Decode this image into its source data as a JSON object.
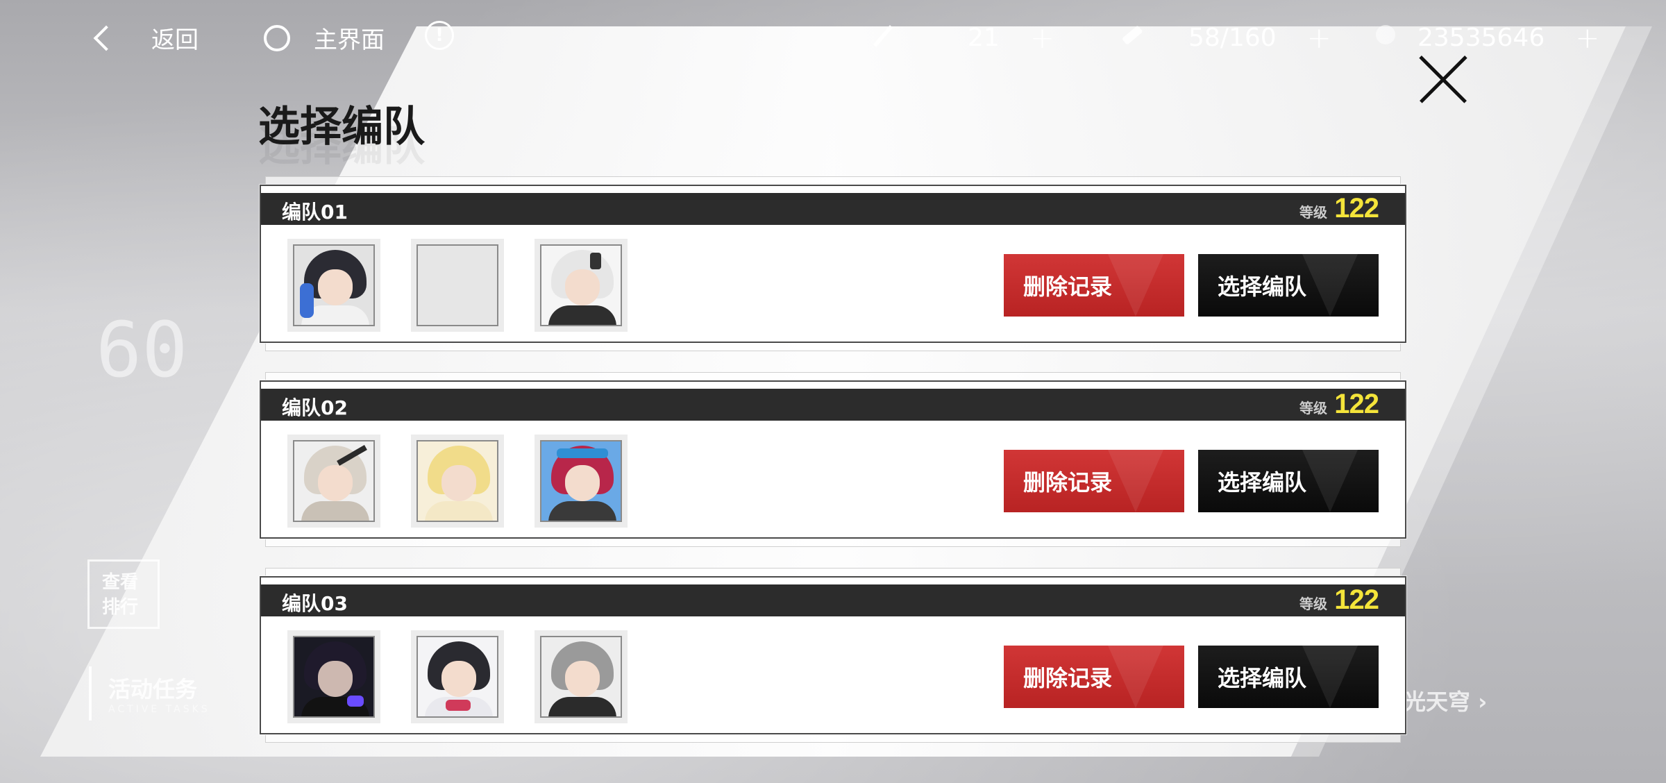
{
  "topbar": {
    "back_label": "返回",
    "home_label": "主界面",
    "info_label": "!",
    "resources": [
      {
        "icon": "energy-icon",
        "value": "21"
      },
      {
        "icon": "stamina-icon",
        "value": "58/160"
      },
      {
        "icon": "currency-icon",
        "value": "23535646"
      }
    ],
    "plus": "+"
  },
  "title": "选择编队",
  "level_label": "等级",
  "teams": [
    {
      "name": "编队01",
      "level": "122",
      "members": [
        {
          "kind": "character",
          "hair": "#2b2b33",
          "accent": "#3c6fd4",
          "body": "#f2f2f2"
        },
        {
          "kind": "empty"
        },
        {
          "kind": "character",
          "hair": "#e6e6e6",
          "accent": "#333333",
          "body": "#2e2e2e"
        }
      ],
      "delete_label": "删除记录",
      "select_label": "选择编队"
    },
    {
      "name": "编队02",
      "level": "122",
      "members": [
        {
          "kind": "character",
          "hair": "#d9d2c8",
          "accent": "#2a2a2a",
          "body": "#c9c1b6"
        },
        {
          "kind": "character",
          "hair": "#f1dc8a",
          "accent": "#e0c36a",
          "body": "#f4e8c6"
        },
        {
          "kind": "character",
          "hair": "#b8264a",
          "accent": "#2f8fd4",
          "body": "#3a3a3a"
        }
      ],
      "delete_label": "删除记录",
      "select_label": "选择编队"
    },
    {
      "name": "编队03",
      "level": "122",
      "members": [
        {
          "kind": "character",
          "hair": "#1f1a2c",
          "accent": "#6a4cff",
          "body": "#121212"
        },
        {
          "kind": "character",
          "hair": "#2a2a30",
          "accent": "#d03a5a",
          "body": "#e9e9ee"
        },
        {
          "kind": "character",
          "hair": "#9a9a9a",
          "accent": "#5a5a5a",
          "body": "#2b2b2b"
        }
      ],
      "delete_label": "删除记录",
      "select_label": "选择编队"
    }
  ],
  "background": {
    "rank_text": "查看排行",
    "active_task": "活动任务",
    "active_task_en": "ACTIVE TASKS",
    "aurora": "极光天穹 ›",
    "big_number": "60"
  },
  "colors": {
    "delete_red": "#c62b2b",
    "select_black": "#111111",
    "level_yellow": "#f4e43a",
    "header_dark": "#2c2c2c"
  }
}
